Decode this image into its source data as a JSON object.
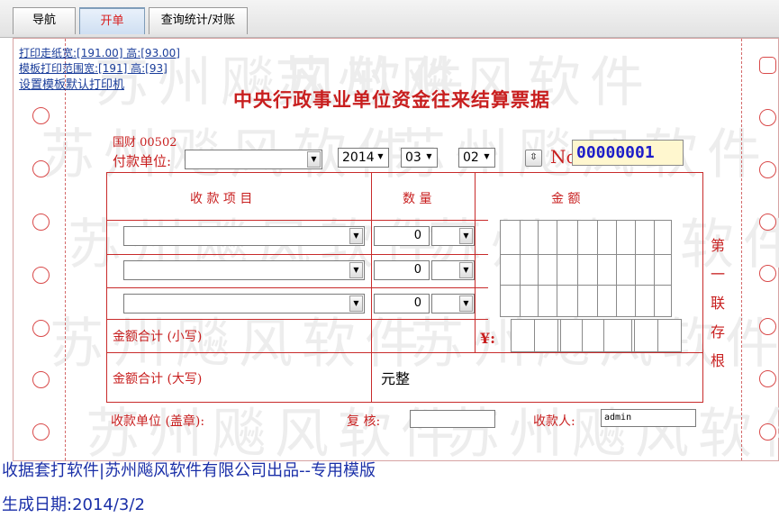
{
  "tabs": [
    {
      "label": "导航"
    },
    {
      "label": "开单"
    },
    {
      "label": "查询统计/对账"
    }
  ],
  "links": {
    "print_paper_size": "打印走纸宽:[191.00] 高:[93.00]",
    "template_print_range": "模板打印范围宽:[191] 高:[93]",
    "set_default_printer": "设置模板默认打印机"
  },
  "watermark": "苏州飚风软件",
  "receipt": {
    "title": "中央行政事业单位资金往来结算票据",
    "caiwu_code": "国财 00502",
    "payer_label": "付款单位:",
    "payer_value": "",
    "date": {
      "year": "2014",
      "month": "03",
      "day": "02"
    },
    "no_label": "No",
    "no_value": "00000001",
    "headers": {
      "item": "收 款 项 目",
      "qty": "数  量",
      "amount": "金     额"
    },
    "rows": [
      {
        "item": "",
        "qty": "0",
        "unit": ""
      },
      {
        "item": "",
        "qty": "0",
        "unit": ""
      },
      {
        "item": "",
        "qty": "0",
        "unit": ""
      }
    ],
    "total_lower_label": "金额合计 (小写)",
    "currency_symbol": "¥:",
    "total_upper_label": "金额合计 (大写)",
    "total_upper_value": "元整",
    "side_label": "第一联存根",
    "receiver_unit_label": "收款单位 (盖章):",
    "review_label": "复  核:",
    "review_value": "",
    "receiver_label": "收款人:",
    "receiver_value": "admin"
  },
  "footer": {
    "line1": "收据套打软件|苏州飚风软件有限公司出品--专用模版",
    "line2": "生成日期:2014/3/2"
  },
  "colors": {
    "accent_red": "#c81f1f",
    "link_blue": "#1a3d9a",
    "footer_blue": "#1a2fa8",
    "number_blue": "#1d1dc9"
  }
}
